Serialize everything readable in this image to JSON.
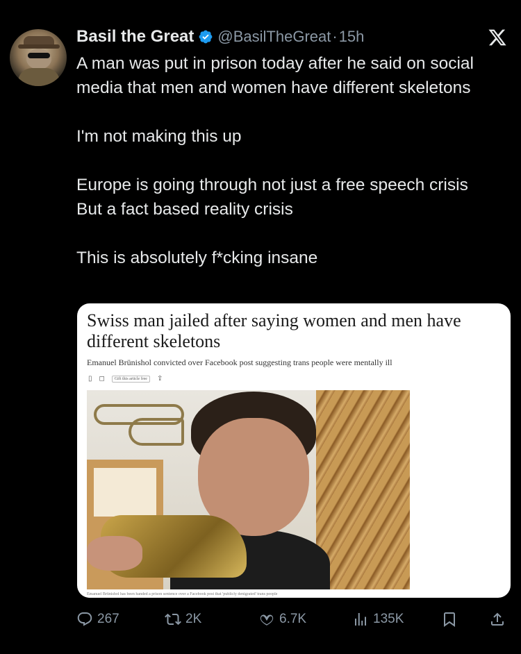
{
  "author": {
    "name": "Basil the Great",
    "handle": "@BasilTheGreat",
    "separator": "·",
    "time": "15h"
  },
  "icons": {
    "verified": "verified-badge-icon",
    "platform": "x-logo-icon",
    "brand_color": "#1d9bf0"
  },
  "tweet": {
    "paragraphs": [
      "A man was put in prison today after he said on social media that men and women have different skeletons",
      "I'm not making this up",
      "Europe is going through not just a free speech crisis\nBut a fact based reality crisis",
      "This is absolutely f*cking insane"
    ]
  },
  "card": {
    "headline": "Swiss man jailed after saying women and men have different skeletons",
    "subheadline": "Emanuel Brünishol convicted over Facebook post suggesting trans people were mentally ill",
    "gift_label": "Gift this article free",
    "caption": "Emanuel Brünishol has been handed a prison sentence over a Facebook post that 'publicly denigrated' trans people"
  },
  "actions": {
    "replies": "267",
    "reposts": "2K",
    "likes": "6.7K",
    "views": "135K"
  }
}
